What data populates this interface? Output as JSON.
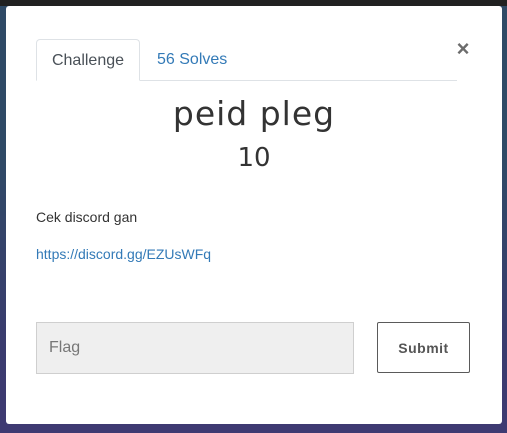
{
  "modal": {
    "tabs": [
      {
        "label": "Challenge"
      },
      {
        "label": "56 Solves"
      }
    ],
    "close_symbol": "×",
    "title": "peid pleg",
    "value": "10",
    "description": "Cek discord gan",
    "link_text": "https://discord.gg/EZUsWFq",
    "flag_placeholder": "Flag",
    "submit_label": "Submit"
  },
  "colors": {
    "link": "#337ab7",
    "backdrop": "#2f4a66",
    "topbar": "#212121"
  }
}
